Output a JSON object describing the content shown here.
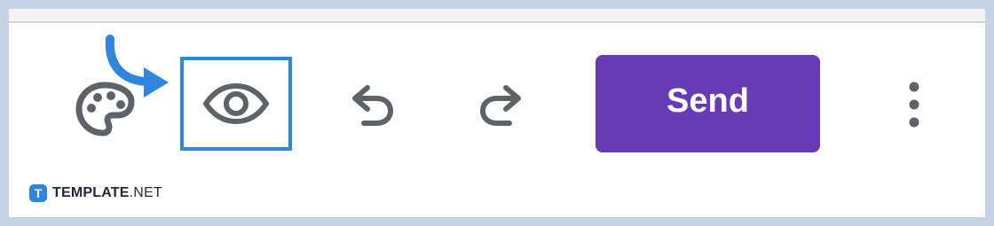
{
  "toolbar": {
    "send_label": "Send"
  },
  "icons": {
    "palette": "palette-icon",
    "preview": "eye-icon",
    "undo": "undo-icon",
    "redo": "redo-icon",
    "more": "more-vertical-icon",
    "pointer": "curved-arrow-icon"
  },
  "colors": {
    "send_button": "#673ab7",
    "highlight_box": "#2e86de",
    "pointer_arrow": "#2e86de",
    "icon_gray": "#5f6368"
  },
  "watermark": {
    "logo_letter": "T",
    "brand_bold": "TEMPLATE",
    "brand_suffix": ".NET"
  }
}
